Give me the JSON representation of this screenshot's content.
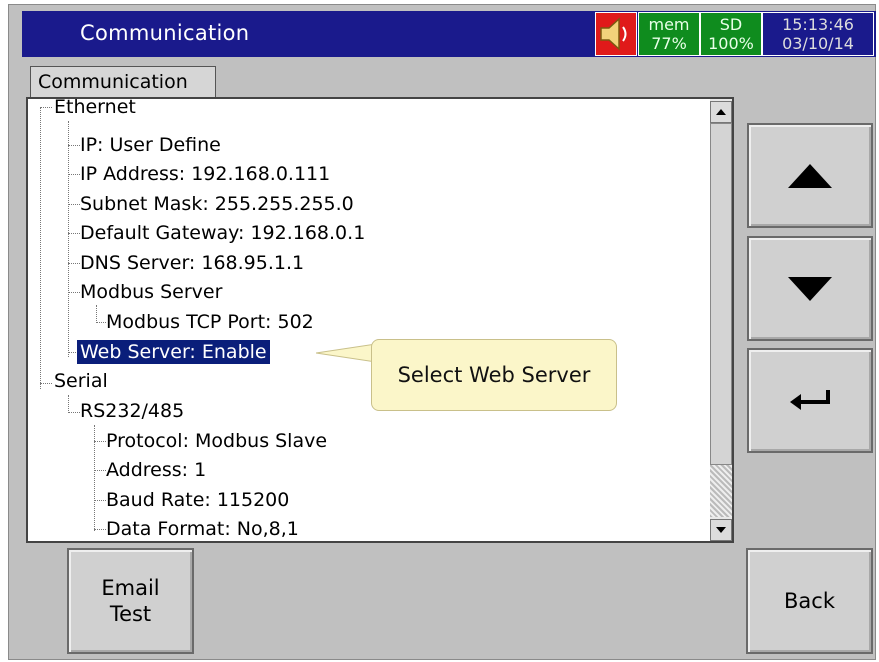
{
  "titlebar": {
    "title": "Communication",
    "speaker_icon": "speaker-icon",
    "mem_label": "mem",
    "mem_value": "77%",
    "sd_label": "SD",
    "sd_value": "100%",
    "time": "15:13:46",
    "date": "03/10/14",
    "colors": {
      "bar": "#1a1a8c",
      "speaker_bg": "#e01a1a",
      "status_bg": "#0f8c1e"
    }
  },
  "tab": {
    "label": "Communication"
  },
  "tree": {
    "ethernet": "Ethernet",
    "ip": "IP: User Define",
    "ip_address": "IP Address: 192.168.0.111",
    "subnet": "Subnet Mask: 255.255.255.0",
    "gateway": "Default Gateway: 192.168.0.1",
    "dns": "DNS Server: 168.95.1.1",
    "modbus_server": "Modbus Server",
    "modbus_port": "Modbus TCP Port: 502",
    "web_server": "Web Server: Enable",
    "serial": "Serial",
    "rs": "RS232/485",
    "protocol": "Protocol: Modbus Slave",
    "address": "Address: 1",
    "baud": "Baud Rate: 115200",
    "data_format": "Data Format: No,8,1"
  },
  "tooltip": {
    "text": "Select Web Server"
  },
  "buttons": {
    "up_icon": "arrow-up-icon",
    "down_icon": "arrow-down-icon",
    "enter_icon": "enter-icon",
    "email_test_line1": "Email",
    "email_test_line2": "Test",
    "back": "Back"
  }
}
